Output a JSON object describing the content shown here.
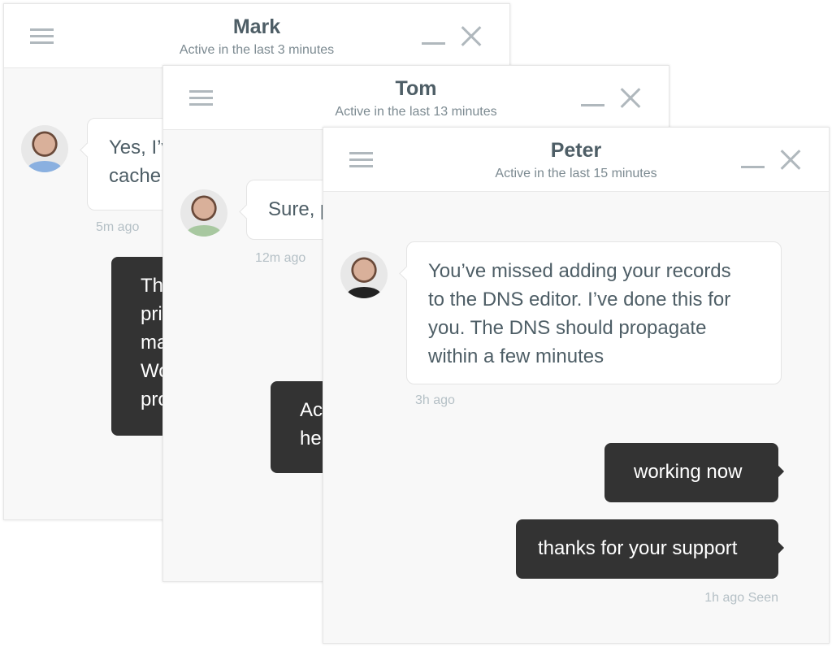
{
  "windows": {
    "mark": {
      "name": "Mark",
      "status": "Active in the last 3 minutes",
      "incoming": {
        "lines": [
          "Yes, I’v",
          "cache"
        ],
        "time": "5m ago"
      },
      "outgoing": {
        "lines": [
          "Th",
          "pri",
          "ma",
          "Wo",
          "pro"
        ]
      }
    },
    "tom": {
      "name": "Tom",
      "status": "Active in the last 13 minutes",
      "incoming": {
        "lines": [
          "Sure, p"
        ],
        "time": "12m ago"
      },
      "outgoing": {
        "lines": [
          "Ac",
          "he"
        ]
      }
    },
    "peter": {
      "name": "Peter",
      "status": "Active in the last 15 minutes",
      "incoming": {
        "lines": [
          "You’ve missed adding your records",
          "to the DNS editor. I’ve done this for",
          "you. The DNS should propagate",
          "within a few minutes"
        ],
        "time": "3h ago"
      },
      "outgoing": [
        {
          "text": "working now"
        },
        {
          "text": "thanks for your support"
        }
      ],
      "outgoing_time": "1h ago Seen"
    }
  },
  "colors": {
    "outgoing_bubble": "#333333",
    "incoming_bubble": "#ffffff",
    "text": "#4e5e66",
    "icon": "#b0b8bd"
  }
}
